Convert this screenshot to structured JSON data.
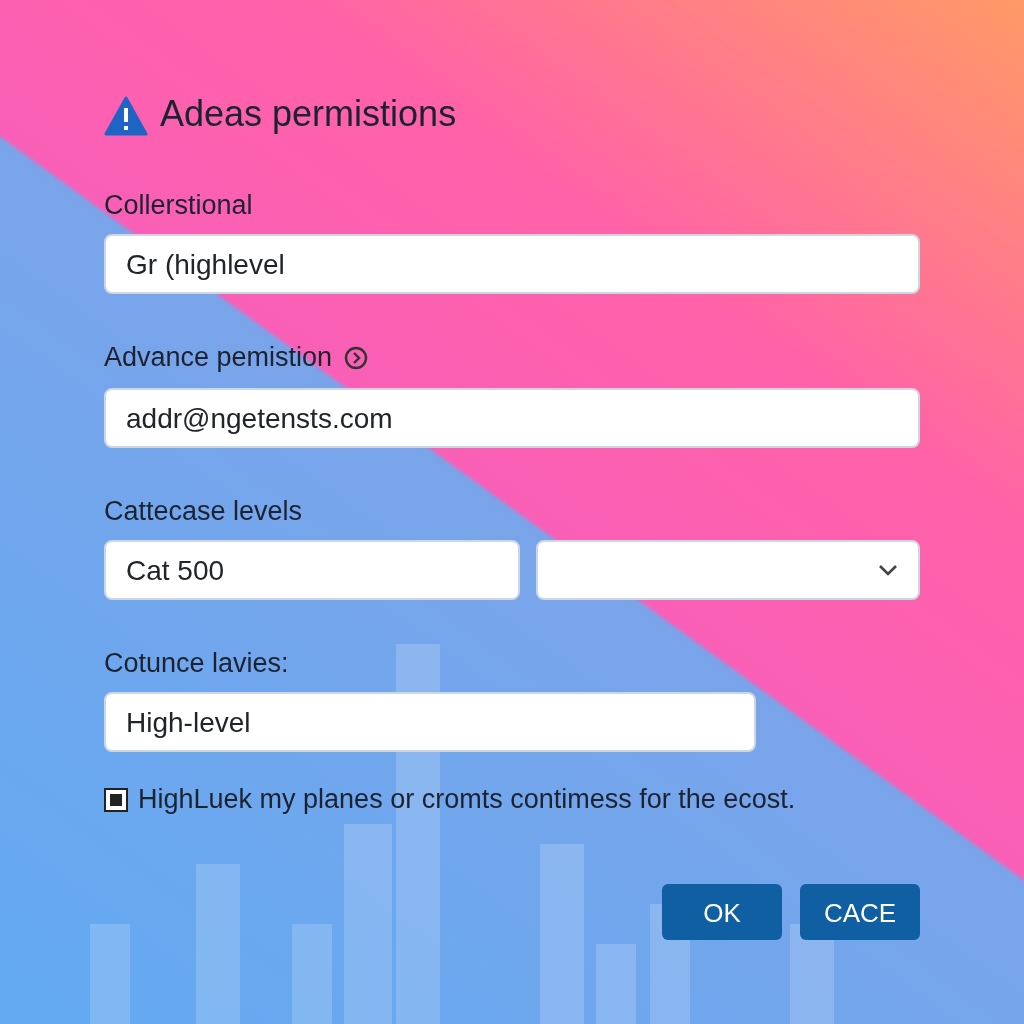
{
  "dialog": {
    "title": "Adeas permistions"
  },
  "fields": [
    {
      "kind": "text",
      "label": "Collerstional",
      "value": "Gr (highlevel"
    },
    {
      "kind": "text",
      "label": "Advance pemistion",
      "help": true,
      "value": "addr@ngetensts.com"
    },
    {
      "kind": "pair",
      "label": "Cattecase levels",
      "value": "Cat 500"
    },
    {
      "kind": "short",
      "label": "Cotunce lavies:",
      "value": "High-level"
    }
  ],
  "checkbox": {
    "label": "HighLuek my planes or cromts contimess for the ecost.",
    "checked": true
  },
  "buttons": [
    "OK",
    "CACE"
  ]
}
